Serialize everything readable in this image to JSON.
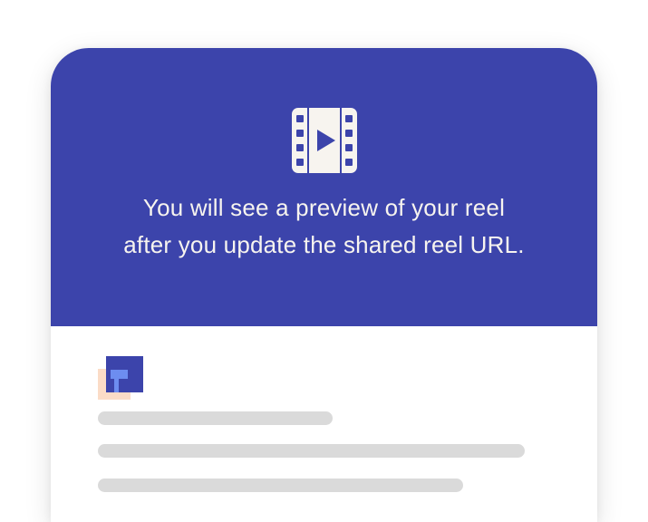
{
  "preview": {
    "icon": "film-play-icon",
    "message_line1": "You will see a preview of your reel",
    "message_line2": "after you update the shared reel URL."
  },
  "brand": {
    "logo": "brand-logo-icon"
  },
  "colors": {
    "accent": "#3c44ab",
    "text_on_accent": "#f7f4ef",
    "placeholder_bar": "#dadada",
    "logo_blue": "#3c44ab",
    "logo_light_blue": "#6d8df0",
    "logo_peach": "#fbdcc7"
  }
}
